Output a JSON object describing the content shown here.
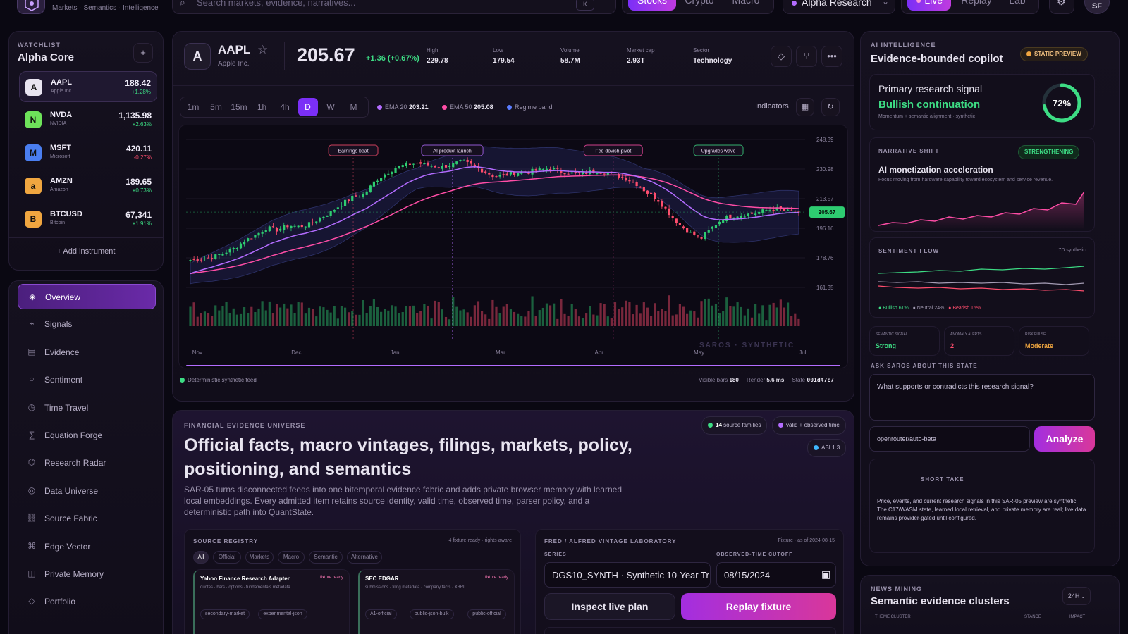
{
  "topbar": {
    "tagline": "Markets · Semantics · Intelligence",
    "search_placeholder": "Search markets, evidence, narratives...",
    "search_key": "K",
    "asset_tabs": [
      "Stocks",
      "Crypto",
      "Macro"
    ],
    "workspace": "Alpha Research",
    "mode_tabs": [
      "Live",
      "Replay",
      "Lab"
    ],
    "user_initials": "SF"
  },
  "watchlist": {
    "caption": "WATCHLIST",
    "title": "Alpha Core",
    "items": [
      {
        "avatar": "A",
        "symbol": "AAPL",
        "name": "Apple Inc.",
        "price": "188.42",
        "change": "+1.28%",
        "color": "#e8e4f0"
      },
      {
        "avatar": "N",
        "symbol": "NVDA",
        "name": "NVIDIA",
        "price": "1,135.98",
        "change": "+2.63%",
        "color": "#6ee35a"
      },
      {
        "avatar": "M",
        "symbol": "MSFT",
        "name": "Microsoft",
        "price": "420.11",
        "change": "-0.27%",
        "color": "#4a7ef0"
      },
      {
        "avatar": "a",
        "symbol": "AMZN",
        "name": "Amazon",
        "price": "189.65",
        "change": "+0.73%",
        "color": "#f0a640"
      },
      {
        "avatar": "B",
        "symbol": "BTCUSD",
        "name": "Bitcoin",
        "price": "67,341",
        "change": "+1.91%",
        "color": "#f0a640"
      }
    ],
    "add_label": "+ Add instrument"
  },
  "nav": [
    {
      "icon": "◈",
      "label": "Overview"
    },
    {
      "icon": "⌁",
      "label": "Signals"
    },
    {
      "icon": "▤",
      "label": "Evidence"
    },
    {
      "icon": "○",
      "label": "Sentiment"
    },
    {
      "icon": "◷",
      "label": "Time Travel"
    },
    {
      "icon": "∑",
      "label": "Equation Forge"
    },
    {
      "icon": "⌬",
      "label": "Research Radar"
    },
    {
      "icon": "◎",
      "label": "Data Universe"
    },
    {
      "icon": "⛓",
      "label": "Source Fabric"
    },
    {
      "icon": "⌘",
      "label": "Edge Vector"
    },
    {
      "icon": "◫",
      "label": "Private Memory"
    },
    {
      "icon": "◇",
      "label": "Portfolio"
    }
  ],
  "header": {
    "avatar": "A",
    "symbol": "AAPL",
    "name": "Apple Inc.",
    "price": "205.67",
    "change": "+1.36 (+0.67%)",
    "stats": [
      {
        "label": "High",
        "value": "229.78"
      },
      {
        "label": "Low",
        "value": "179.54"
      },
      {
        "label": "Volume",
        "value": "58.7M"
      },
      {
        "label": "Market cap",
        "value": "2.93T"
      },
      {
        "label": "Sector",
        "value": "Technology"
      }
    ]
  },
  "chart_toolbar": {
    "timeframes": [
      "1m",
      "5m",
      "15m",
      "1h",
      "4h",
      "D",
      "W",
      "M"
    ],
    "active": "D",
    "legend": [
      {
        "label": "EMA 20",
        "value": "203.21",
        "color": "#b36cff"
      },
      {
        "label": "EMA 50",
        "value": "205.08",
        "color": "#ff4da6"
      },
      {
        "label": "Regime band",
        "value": "",
        "color": "#5a7cff"
      }
    ],
    "indicators_label": "Indicators"
  },
  "chart_data": {
    "type": "candlestick",
    "x_ticks": [
      "Nov",
      "Dec",
      "Jan",
      "Mar",
      "Apr",
      "May",
      "Jul"
    ],
    "y_ticks": [
      248.39,
      230.98,
      213.57,
      196.16,
      178.76,
      161.35
    ],
    "ylim": [
      161.35,
      248.39
    ],
    "last_price": "205.67",
    "watermark": "SAROS · SYNTHETIC",
    "annotations": [
      {
        "label": "Earnings beat",
        "x_frac_note": "Dec"
      },
      {
        "label": "AI product launch",
        "x_frac_note": "Jan"
      },
      {
        "label": "Fed dovish pivot",
        "x_frac_note": "Apr"
      },
      {
        "label": "Upgrades wave",
        "x_frac_note": "May"
      }
    ],
    "close_series": [
      177.5,
      178.2,
      179.0,
      181.5,
      184.2,
      188.9,
      192.1,
      196.4,
      195.2,
      197.8,
      197.1,
      198.6,
      202.3,
      206.1,
      210.8,
      214.6,
      216.2,
      224.0,
      228.4,
      232.1,
      233.8,
      234.5,
      233.2,
      232.0,
      233.6,
      235.4,
      233.1,
      229.8,
      226.6,
      227.5,
      228.8,
      229.4,
      230.2,
      231.5,
      229.7,
      228.6,
      228.0,
      229.8,
      229.5,
      227.9,
      225.7,
      222.6,
      217.4,
      213.2,
      205.6,
      198.2,
      193.5,
      190.1,
      196.5,
      201.8,
      203.5,
      204.2,
      205.0,
      206.8,
      207.5,
      206.0,
      205.67
    ],
    "ema20_end": 203.21,
    "ema50_end": 205.08,
    "footer": {
      "feed": "Deterministic synthetic feed",
      "visible_bars_label": "Visible bars",
      "visible_bars": "180",
      "render_label": "Render",
      "render": "5.6 ms",
      "state_label": "State",
      "state": "001d47c7"
    }
  },
  "evidence": {
    "caption": "FINANCIAL EVIDENCE UNIVERSE",
    "title": "Official facts, macro vintages, filings, markets, policy, positioning, and semantics",
    "body": "SAR-05 turns disconnected feeds into one bitemporal evidence fabric and adds private browser memory with learned local embeddings. Every admitted item retains source identity, valid time, observed time, parser policy, and a deterministic path into QuantState.",
    "chips": [
      {
        "bold": "14",
        "text": " source families",
        "color": "#3ddc84"
      },
      {
        "bold": "",
        "text": "valid + observed time",
        "color": "#b36cff"
      },
      {
        "bold": "",
        "text": "ABI 1.3",
        "color": "#3fb8ff"
      }
    ],
    "registry": {
      "caption": "SOURCE REGISTRY",
      "meta": "4 fixture-ready · rights-aware",
      "filters": [
        "All",
        "Official",
        "Markets",
        "Macro",
        "Semantic",
        "Alternative"
      ],
      "cards": [
        {
          "title": "Yahoo Finance Research Adapter",
          "badge": "fixture ready",
          "desc": "quotes · bars · options · fundamentals metadata",
          "tags": [
            "secondary-market",
            "experimental-json"
          ]
        },
        {
          "title": "SEC EDGAR",
          "badge": "fixture ready",
          "desc": "submissions · filing metadata · company facts · XBRL",
          "tags": [
            "A1-official",
            "public-json-bulk",
            "public-official"
          ]
        }
      ]
    },
    "vintage": {
      "caption": "FRED / ALFRED VINTAGE LABORATORY",
      "meta": "Fixture · as of 2024-08-15",
      "series_label": "SERIES",
      "series_value": "DGS10_SYNTH · Synthetic 10-Year Tr",
      "cutoff_label": "OBSERVED-TIME CUTOFF",
      "cutoff_value": "08/15/2024",
      "inspect": "Inspect live plan",
      "replay": "Replay fixture"
    }
  },
  "copilot": {
    "caption": "AI INTELLIGENCE",
    "title": "Evidence-bounded copilot",
    "badge": "STATIC PREVIEW",
    "signal": {
      "label": "Primary research signal",
      "value": "Bullish continuation",
      "sub": "Momentum + semantic alignment · synthetic",
      "gauge": "72%",
      "gauge_frac": 0.72
    },
    "narrative": {
      "caption": "NARRATIVE SHIFT",
      "badge": "STRENGTHENING",
      "title": "AI monetization acceleration",
      "desc": "Focus moving from hardware capability toward ecosystem and service revenue."
    },
    "sentiment": {
      "caption": "SENTIMENT FLOW",
      "range": "7D synthetic",
      "bullish": "Bullish 61%",
      "neutral": "Neutral 24%",
      "bearish": "Bearish 15%"
    },
    "metrics": [
      {
        "label": "SEMANTIC SIGNAL",
        "value": "Strong",
        "color": "#3ddc84"
      },
      {
        "label": "ANOMALY ALERTS",
        "value": "2",
        "color": "#ff4d6d"
      },
      {
        "label": "RISK PULSE",
        "value": "Moderate",
        "color": "#f0a640"
      }
    ],
    "ask_caption": "ASK SAROS ABOUT THIS STATE",
    "question": "What supports or contradicts this research signal?",
    "model": "openrouter/auto-beta",
    "analyze": "Analyze",
    "short_take_caption": "SHORT TAKE",
    "short_take": "Price, events, and current research signals in this SAR-05 preview are synthetic. The C17/WASM state, learned local retrieval, and private memory are real; live data remains provider-gated until configured."
  },
  "news": {
    "caption": "NEWS MINING",
    "title": "Semantic evidence clusters",
    "range": "24H",
    "columns": [
      "THEME CLUSTER",
      "STANCE",
      "IMPACT"
    ]
  }
}
